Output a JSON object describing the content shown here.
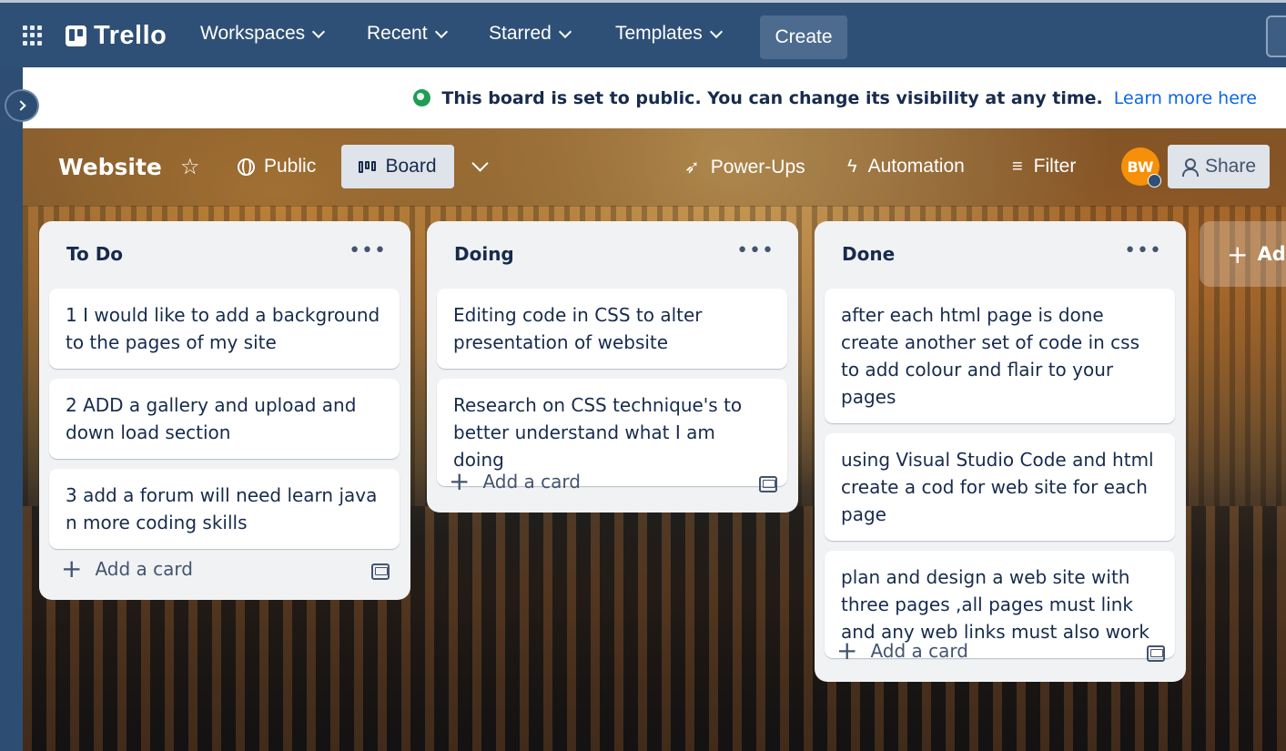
{
  "topnav": {
    "logo": "Trello",
    "items": [
      {
        "label": "Workspaces"
      },
      {
        "label": "Recent"
      },
      {
        "label": "Starred"
      },
      {
        "label": "Templates"
      }
    ],
    "create_label": "Create"
  },
  "banner": {
    "text": "This board is set to public. You can change its visibility at any time.",
    "link": "Learn more here"
  },
  "board": {
    "title": "Website",
    "visibility_label": "Public",
    "view_label": "Board",
    "powerups_label": "Power-Ups",
    "automation_label": "Automation",
    "filter_label": "Filter",
    "avatar_initials": "BW",
    "share_label": "Share",
    "add_list_label": "Add"
  },
  "lists": [
    {
      "title": "To Do",
      "cards": [
        "1 I would like to add a background to the pages of my site",
        "2 ADD a gallery and upload and down load section",
        "3 add a forum will need learn java n more coding skills"
      ],
      "add_card_label": "Add a card"
    },
    {
      "title": "Doing",
      "cards": [
        "Editing code in CSS to alter presentation of website",
        "Research on CSS technique's to better understand what I am doing"
      ],
      "add_card_label": "Add a card"
    },
    {
      "title": "Done",
      "cards": [
        "after each html page is done create another set of code in css to add colour and flair to your pages",
        "using Visual Studio Code and html create a cod for web site for each page",
        "plan and design a web site with three pages ,all pages must link and any web links must also work"
      ],
      "add_card_label": "Add a card"
    }
  ],
  "colors": {
    "nav_bg": "#2f5076",
    "list_bg": "#f1f2f4",
    "link": "#0c66e4",
    "avatar": "#f79009"
  }
}
